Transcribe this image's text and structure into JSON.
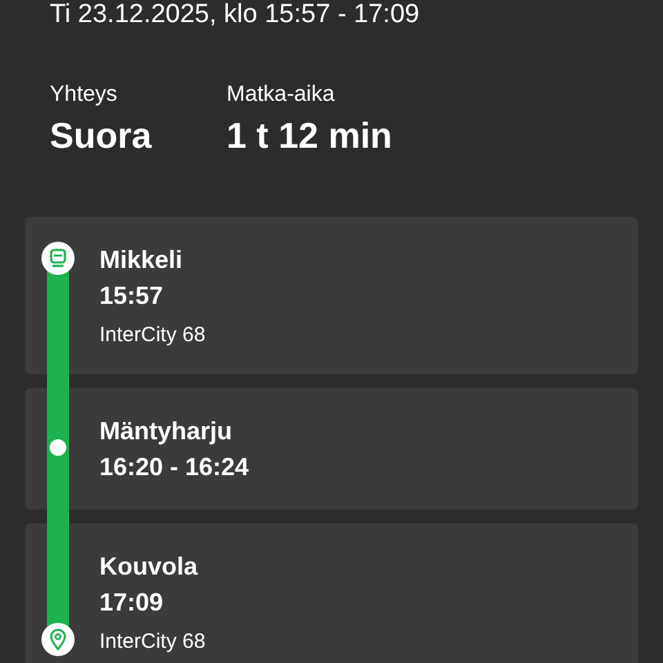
{
  "header": {
    "date_time": "Ti 23.12.2025, klo 15:57 - 17:09"
  },
  "summary": [
    {
      "label": "Yhteys",
      "value": "Suora"
    },
    {
      "label": "Matka-aika",
      "value": "1 t 12 min"
    }
  ],
  "stops": [
    {
      "kind": "origin",
      "name": "Mikkeli",
      "time": "15:57",
      "train": "InterCity 68"
    },
    {
      "kind": "via",
      "name": "Mäntyharju",
      "time": "16:20 - 16:24"
    },
    {
      "kind": "destination",
      "name": "Kouvola",
      "time": "17:09",
      "train": "InterCity 68"
    }
  ]
}
